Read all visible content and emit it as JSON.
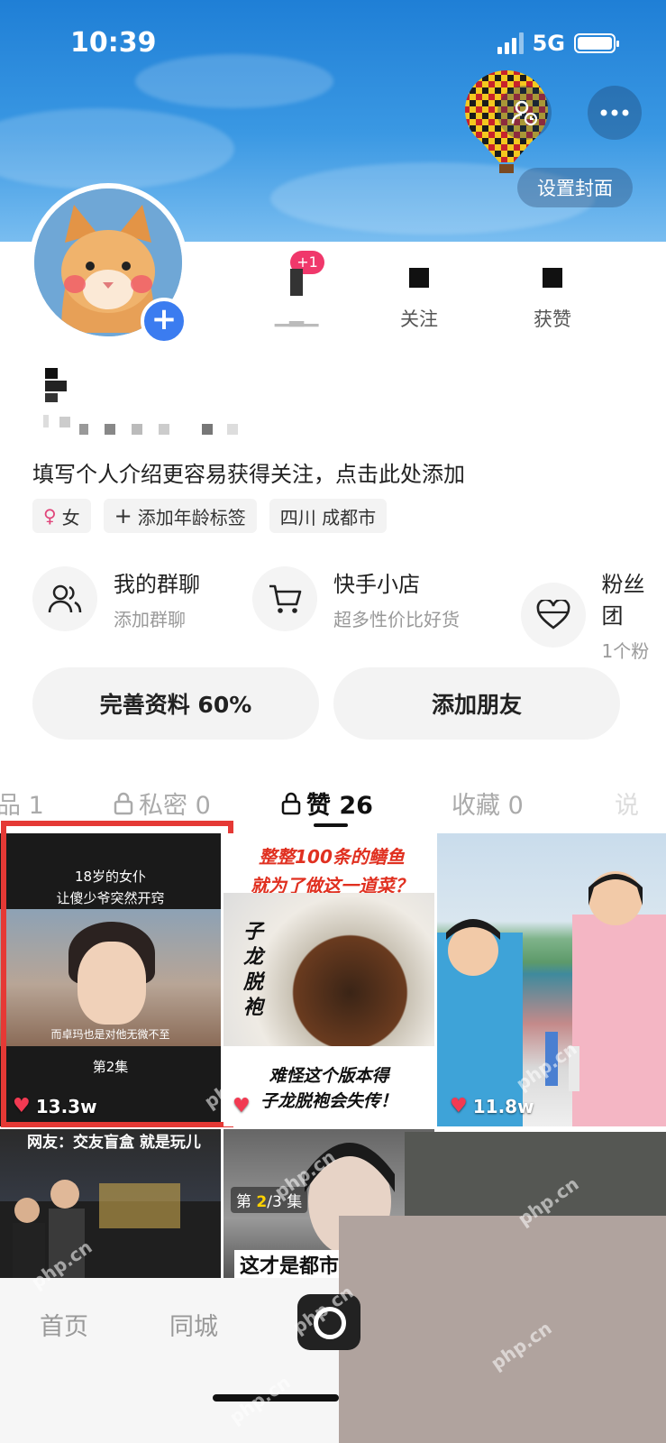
{
  "status_bar": {
    "time": "10:39",
    "network": "5G"
  },
  "cover": {
    "set_cover_label": "设置封面"
  },
  "profile": {
    "notification_badge": "+1"
  },
  "stats": [
    {
      "label": "关注"
    },
    {
      "label": "获赞"
    }
  ],
  "bio": {
    "placeholder": "填写个人介绍更容易获得关注，点击此处添加",
    "tags": {
      "gender": "女",
      "gender_symbol": "♀",
      "age": "添加年龄标签",
      "location": "四川 成都市"
    }
  },
  "services": [
    {
      "title": "我的群聊",
      "subtitle": "添加群聊",
      "icon": "group-icon"
    },
    {
      "title": "快手小店",
      "subtitle": "超多性价比好货",
      "icon": "cart-icon"
    },
    {
      "title": "粉丝团",
      "subtitle": "1个粉",
      "icon": "heart-icon"
    }
  ],
  "buttons": {
    "complete_profile": "完善资料 60%",
    "add_friend": "添加朋友"
  },
  "tabs": [
    {
      "label": "品 1",
      "active": false
    },
    {
      "label": "私密 0",
      "active": false,
      "icon": "lock-icon"
    },
    {
      "label": "赞 26",
      "active": true,
      "icon": "lock-icon"
    },
    {
      "label": "收藏 0",
      "active": false
    },
    {
      "label": "说",
      "active": false
    }
  ],
  "videos": [
    {
      "title_line1": "18岁的女仆",
      "title_line2": "让傻少爷突然开窍",
      "subtitle": "而卓玛也是对他无微不至",
      "episode": "第2集",
      "likes": "13.3w"
    },
    {
      "title_line1": "整整100条的鳝鱼",
      "title_line2": "就为了做这一道菜？",
      "vertical_text": "子龙脱袍",
      "caption_line1": "难怪这个版本得",
      "caption_line2": "子龙脱袍会失传！"
    },
    {
      "likes": "11.8w"
    },
    {
      "title": "网友：交友盲盒 就是玩儿"
    },
    {
      "episode_prefix": "第 ",
      "episode_current": "2",
      "episode_suffix": "/3 集",
      "caption": "这才是都市"
    }
  ],
  "bottom_nav": {
    "home": "首页",
    "local": "同城"
  },
  "watermark": "php.cn",
  "colors": {
    "accent_blue": "#3b7cf0",
    "like_red": "#f23a52",
    "highlight_red": "#e53935",
    "badge_pink": "#f0386b"
  }
}
